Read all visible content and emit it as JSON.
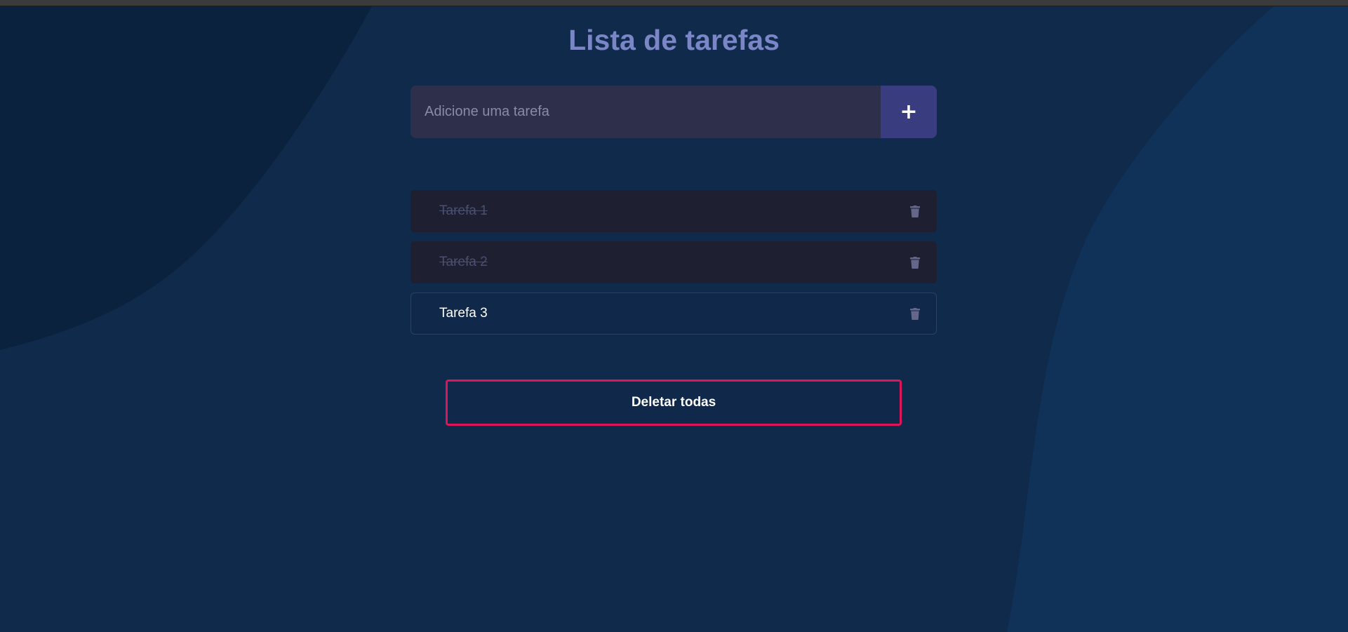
{
  "title": "Lista de tarefas",
  "input": {
    "placeholder": "Adicione uma tarefa",
    "value": ""
  },
  "add_button": {
    "label": "+",
    "icon": "plus-icon"
  },
  "tasks": [
    {
      "label": "Tarefa 1",
      "completed": true,
      "delete_icon": "trash-icon"
    },
    {
      "label": "Tarefa 2",
      "completed": true,
      "delete_icon": "trash-icon"
    },
    {
      "label": "Tarefa 3",
      "completed": false,
      "delete_icon": "trash-icon"
    }
  ],
  "delete_all_label": "Deletar todas",
  "colors": {
    "background": "#0f2a4a",
    "title": "#7b86c6",
    "input_bg": "#2e304b",
    "add_button_bg": "#393c7f",
    "done_task_bg": "#1e1f30",
    "danger_border": "#e0145a"
  }
}
